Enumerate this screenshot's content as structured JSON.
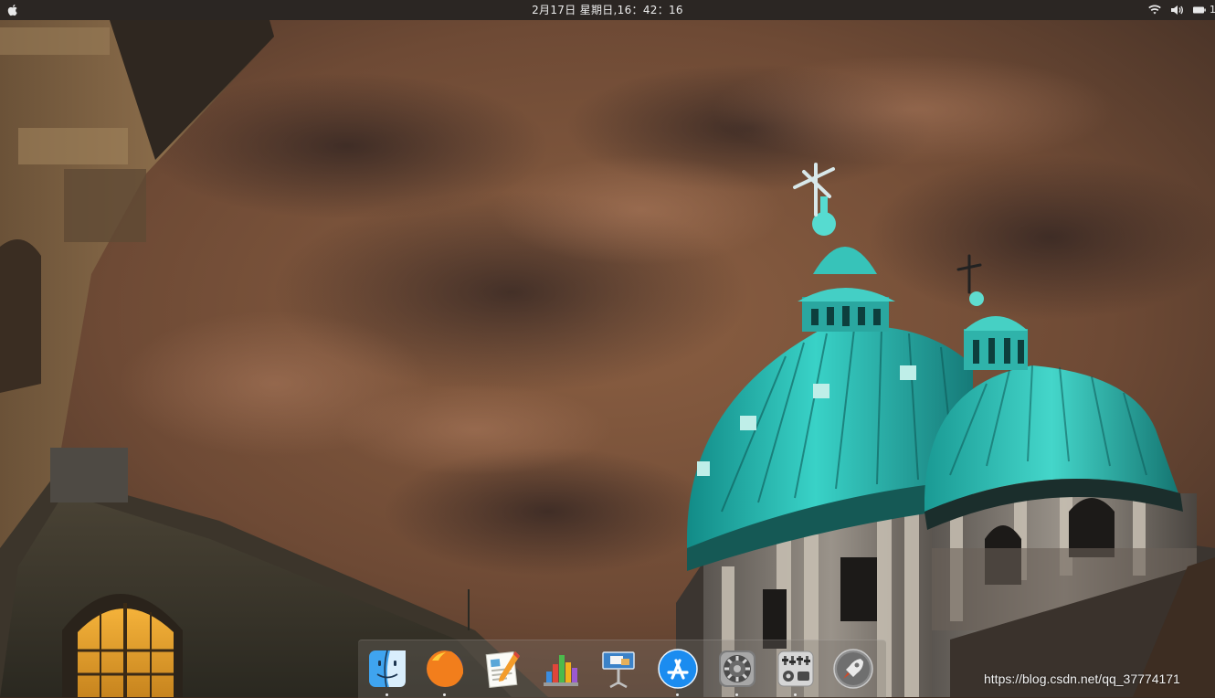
{
  "menubar": {
    "clock": "2月17日 星期日,16：42：16",
    "tray_number": "1",
    "icons": [
      "apple-logo-icon",
      "wifi-icon",
      "volume-icon",
      "battery-icon"
    ]
  },
  "dock": {
    "items": [
      {
        "name": "finder",
        "icon": "finder-icon",
        "running": true
      },
      {
        "name": "firefox",
        "icon": "firefox-icon",
        "running": true
      },
      {
        "name": "pages",
        "icon": "pages-icon",
        "running": false
      },
      {
        "name": "numbers",
        "icon": "numbers-icon",
        "running": false
      },
      {
        "name": "keynote",
        "icon": "keynote-icon",
        "running": false
      },
      {
        "name": "app-store",
        "icon": "app-store-icon",
        "running": true
      },
      {
        "name": "system-preferences",
        "icon": "system-preferences-icon",
        "running": true
      },
      {
        "name": "control-panel",
        "icon": "control-panel-icon",
        "running": true
      },
      {
        "name": "launchpad",
        "icon": "launchpad-icon",
        "running": false
      }
    ]
  },
  "watermark": "https://blog.csdn.net/qq_37774171",
  "colors": {
    "menubar_bg": "#2b2623",
    "sky": "#7a5238",
    "dome": "#2fb8b0",
    "dock_bg": "rgba(120,115,110,0.32)"
  }
}
